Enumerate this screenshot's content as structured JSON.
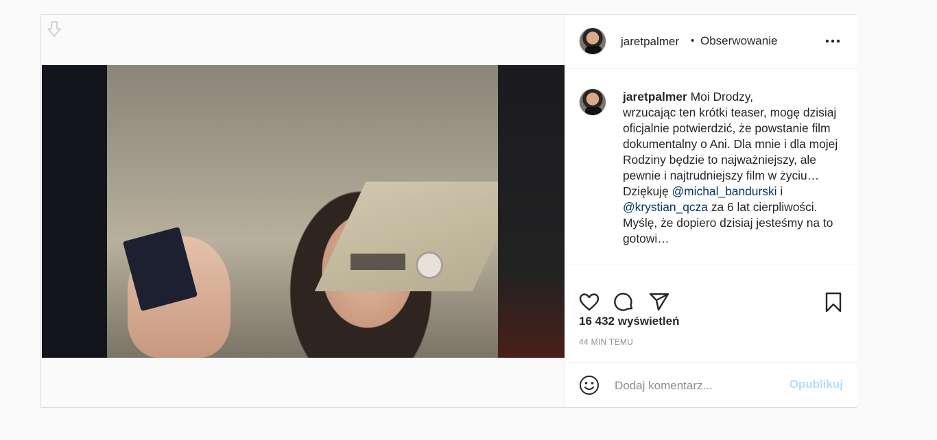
{
  "post": {
    "header": {
      "username": "jaretpalmer",
      "separator": "•",
      "follow_status": "Obserwowanie",
      "avatar_icon": "profile-avatar",
      "more_icon": "more-options-icon"
    },
    "caption": {
      "username": "jaretpalmer",
      "line1": " Moi Drodzy,\nwrzucając ten krótki teaser, mogę dzisiaj oficjalnie potwierdzić, że powstanie film dokumentalny o Ani. Dla mnie i dla mojej Rodziny będzie to najważniejszy, ale pewnie i najtrudniejszy film w życiu…\nDziękuję ",
      "mention1": "@michal_bandurski",
      "between": " i ",
      "mention2": "@krystian_qcza",
      "line2": " za 6 lat cierpliwości.\nMyślę, że dopiero dzisiaj jesteśmy na to gotowi…"
    },
    "stats": {
      "views": "16 432 wyświetleń",
      "time": "44 MIN TEMU"
    },
    "comment": {
      "placeholder": "Dodaj komentarz...",
      "publish_label": "Opublikuj"
    },
    "icons": [
      "download-icon",
      "heart-icon",
      "comment-icon",
      "share-icon",
      "bookmark-icon",
      "emoji-icon"
    ],
    "colors": {
      "link": "#00376b",
      "publish_disabled": "#b2dffc",
      "muted": "#8e8e8e"
    }
  }
}
